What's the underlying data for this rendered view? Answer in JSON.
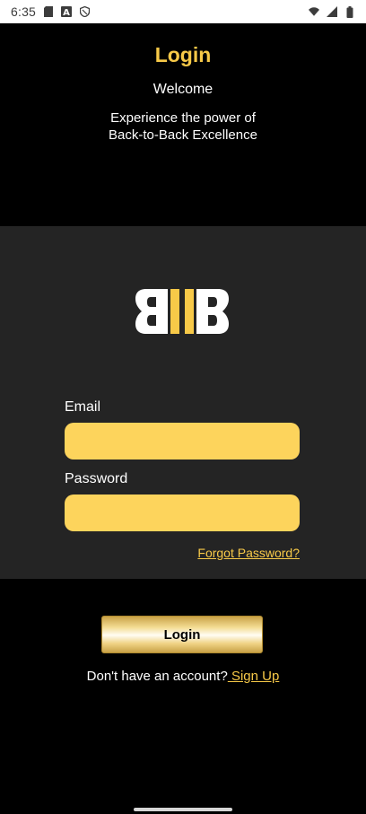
{
  "status_bar": {
    "time": "6:35",
    "left_icons": [
      "sd-card-icon",
      "font-a-icon",
      "shield-icon"
    ],
    "right_icons": [
      "wifi-icon",
      "cell-signal-icon",
      "battery-icon"
    ]
  },
  "header": {
    "title": "Login",
    "welcome": "Welcome",
    "tagline_line1": "Experience the power of",
    "tagline_line2": "Back-to-Back Excellence"
  },
  "logo": {
    "name": "bb-logo-icon"
  },
  "form": {
    "email_label": "Email",
    "email_value": "",
    "password_label": "Password",
    "password_value": "",
    "forgot_password": "Forgot Password?"
  },
  "actions": {
    "login_button": "Login",
    "signup_prompt": "Don't have an account?",
    "signup_link": " Sign Up"
  },
  "colors": {
    "accent": "#f7c948",
    "input_fill": "#fdd45c",
    "panel_bg": "#242424",
    "page_bg": "#000000"
  }
}
